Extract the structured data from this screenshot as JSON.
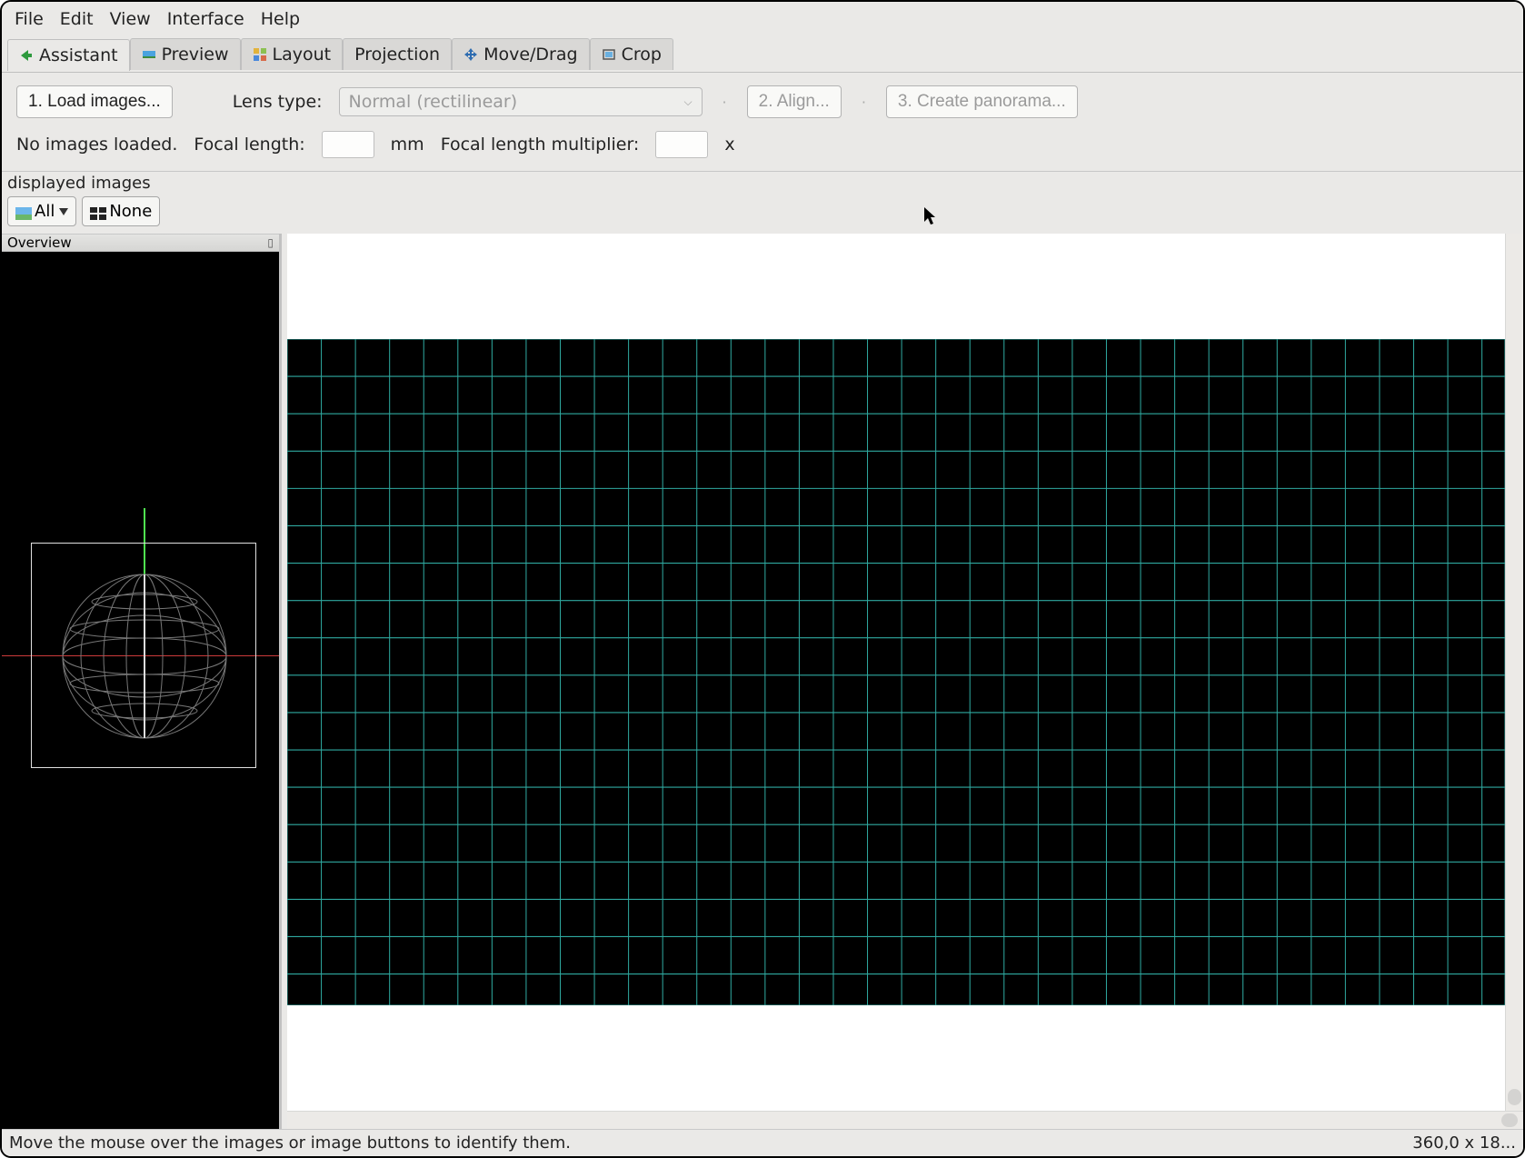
{
  "menu": {
    "file": "File",
    "edit": "Edit",
    "view": "View",
    "interface": "Interface",
    "help": "Help"
  },
  "tabs": {
    "assistant": "Assistant",
    "preview": "Preview",
    "layout": "Layout",
    "projection": "Projection",
    "movedrag": "Move/Drag",
    "crop": "Crop"
  },
  "assistant": {
    "load_btn": "1. Load images...",
    "lens_type_label": "Lens type:",
    "lens_type_value": "Normal (rectilinear)",
    "align_btn": "2. Align...",
    "create_btn": "3. Create panorama...",
    "no_images": "No images loaded.",
    "focal_length_label": "Focal length:",
    "mm_unit": "mm",
    "focal_mult_label": "Focal length multiplier:",
    "x_unit": "x"
  },
  "displayed": {
    "title": "displayed images",
    "all": "All",
    "none": "None"
  },
  "overview": {
    "title": "Overview"
  },
  "status": {
    "hint": "Move the mouse over the images or image buttons to identify them.",
    "coords": "360,0 x 18..."
  }
}
